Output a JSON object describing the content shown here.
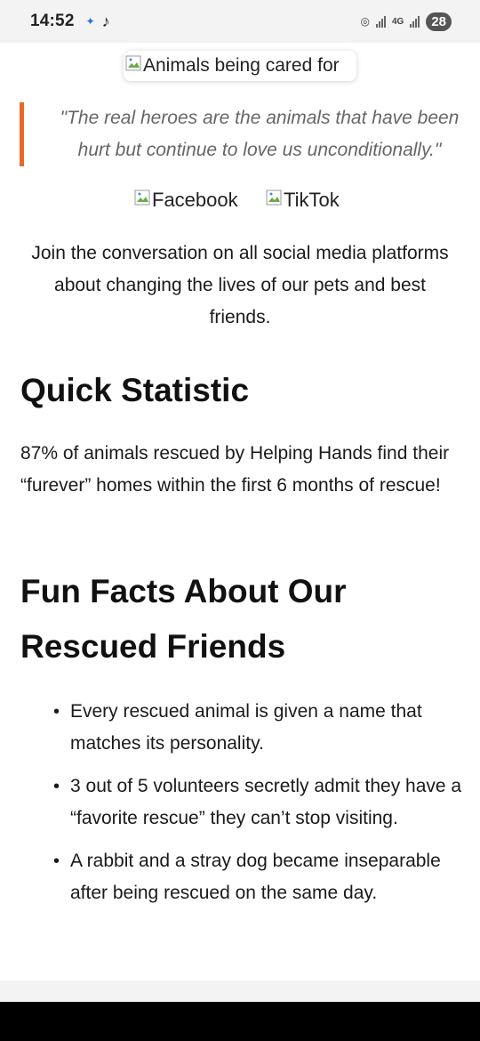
{
  "status": {
    "time": "14:52",
    "network": "4G",
    "battery": "28"
  },
  "hero_image": {
    "alt": "Animals being cared for"
  },
  "quote": "\"The real heroes are the animals that have been hurt but continue to love us unconditionally.\"",
  "social": {
    "facebook": "Facebook",
    "tiktok": "TikTok"
  },
  "join_text": "Join the conversation on all social media platforms about changing the lives of our pets and best friends.",
  "statistic": {
    "heading": "Quick Statistic",
    "text": "87% of animals rescued by Helping Hands find their “furever” homes within the first 6 months of rescue!"
  },
  "fun_facts": {
    "heading": "Fun Facts About Our Rescued Friends",
    "items": [
      "Every rescued animal is given a name that matches its personality.",
      "3 out of 5 volunteers secretly admit they have a “favorite rescue” they can’t stop visiting.",
      "A rabbit and a stray dog became inseparable after being rescued on the same day."
    ]
  }
}
